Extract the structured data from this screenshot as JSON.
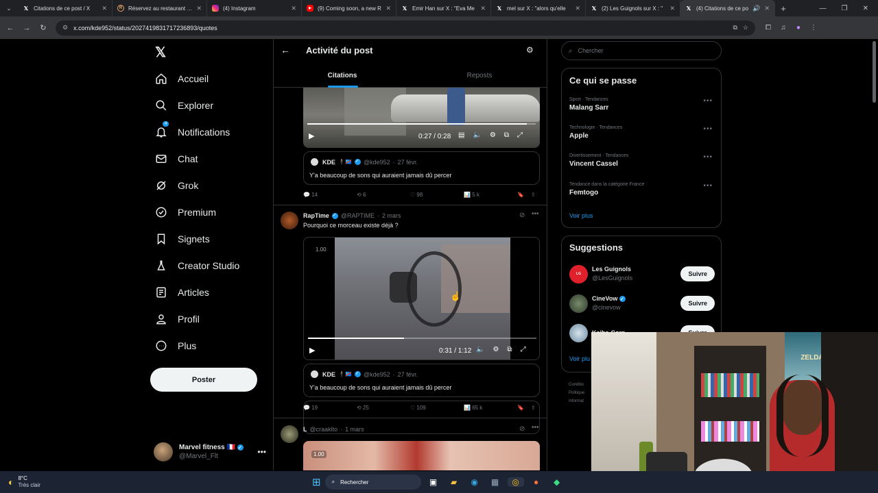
{
  "browser": {
    "tabs": [
      {
        "title": "Citations de ce post / X",
        "icon": "x-logo-icon",
        "active": false
      },
      {
        "title": "Réservez au restaurant Le",
        "icon": "restaurant-icon",
        "active": false
      },
      {
        "title": "(4) Instagram",
        "icon": "instagram-icon",
        "active": false
      },
      {
        "title": "(9) Coming soon, a new R",
        "icon": "youtube-icon",
        "active": false
      },
      {
        "title": "Emir Han sur X : \"Eva Me",
        "icon": "x-logo-icon",
        "active": false
      },
      {
        "title": "mel sur X : \"alors qu'elle",
        "icon": "x-logo-icon",
        "active": false
      },
      {
        "title": "(2) Les Guignols sur X : \"",
        "icon": "x-logo-icon",
        "active": false
      },
      {
        "title": "(4) Citations de ce po",
        "icon": "x-logo-icon",
        "active": true
      }
    ],
    "url": "x.com/kde952/status/2027419831717236893/quotes"
  },
  "nav": {
    "items": [
      {
        "label": "Accueil",
        "icon": "home-icon"
      },
      {
        "label": "Explorer",
        "icon": "search-icon"
      },
      {
        "label": "Notifications",
        "icon": "bell-icon",
        "badge": "4"
      },
      {
        "label": "Chat",
        "icon": "mail-icon"
      },
      {
        "label": "Grok",
        "icon": "grok-icon"
      },
      {
        "label": "Premium",
        "icon": "premium-icon"
      },
      {
        "label": "Signets",
        "icon": "bookmark-icon"
      },
      {
        "label": "Creator Studio",
        "icon": "flask-icon"
      },
      {
        "label": "Articles",
        "icon": "article-icon"
      },
      {
        "label": "Profil",
        "icon": "person-icon"
      },
      {
        "label": "Plus",
        "icon": "more-circle-icon"
      }
    ],
    "post_button": "Poster",
    "account": {
      "name": "Marvel fitness 🇫🇷",
      "handle": "@Marvel_Flt"
    }
  },
  "header": {
    "title": "Activité du post",
    "tabs": [
      "Citations",
      "Reposts"
    ]
  },
  "posts": [
    {
      "video_time": "0:27 / 0:28",
      "video_progress": 0.96,
      "quote": {
        "name": "KDE",
        "handle": "@kde952",
        "date": "27 févr.",
        "text": "Y'a beaucoup de sons qui auraient jamais dû percer"
      },
      "stats": {
        "replies": "14",
        "reposts": "6",
        "likes": "98",
        "views": "5 k"
      }
    },
    {
      "author": "RapTime",
      "handle": "@RAPTIME",
      "date": "2 mars",
      "text": "Pourquoi ce morceau existe déjà ?",
      "video_time": "0:31 / 1:12",
      "video_speed": "1.00",
      "video_progress": 0.42,
      "quote": {
        "name": "KDE",
        "handle": "@kde952",
        "date": "27 févr.",
        "text": "Y'a beaucoup de sons qui auraient jamais dû percer"
      },
      "stats": {
        "replies": "19",
        "reposts": "25",
        "likes": "109",
        "views": "65 k"
      }
    },
    {
      "author": "L",
      "handle": "@craaklto",
      "date": "1 mars",
      "video_speed": "1.00"
    }
  ],
  "right": {
    "search_placeholder": "Chercher",
    "trends_title": "Ce qui se passe",
    "trends": [
      {
        "context": "Sport · Tendances",
        "name": "Malang Sarr"
      },
      {
        "context": "Technologie · Tendances",
        "name": "Apple"
      },
      {
        "context": "Divertissement · Tendances",
        "name": "Vincent Cassel"
      },
      {
        "context": "Tendance dans la catégorie France",
        "name": "Femtogo"
      }
    ],
    "trends_more": "Voir plus",
    "suggestions_title": "Suggestions",
    "suggestions": [
      {
        "name": "Les Guignols",
        "handle": "@LesGuignols",
        "verified": false,
        "button": "Suivre"
      },
      {
        "name": "CineVow",
        "handle": "@cinevow",
        "verified": true,
        "button": "Suivre"
      },
      {
        "name": "Kaiba-Corp",
        "handle": "",
        "verified": false,
        "button": "Suivre"
      }
    ],
    "suggestions_more": "Voir plu",
    "footer": [
      "Conditio",
      "Politique",
      "Informat"
    ]
  },
  "taskbar": {
    "weather_temp": "8°C",
    "weather_text": "Très clair",
    "search": "Rechercher"
  },
  "webcam": {
    "poster_text": "ZELDA"
  },
  "colors": {
    "accent": "#1d9bf0",
    "background": "#000000",
    "border": "#2f3336",
    "muted": "#71767b"
  }
}
